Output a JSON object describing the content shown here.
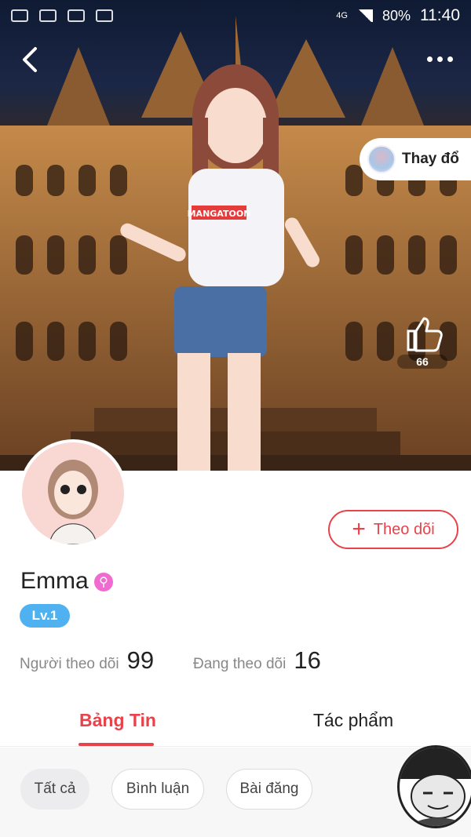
{
  "status_bar": {
    "time": "11:40",
    "battery": "80%",
    "network": "4G"
  },
  "header": {
    "back_icon": "chevron-left-icon",
    "more_icon": "more-horizontal-icon"
  },
  "hero": {
    "shirt_text": "MANGATOON",
    "change_button_label": "Thay đổ",
    "like_count": "66"
  },
  "profile": {
    "name": "Emma",
    "gender_icon": "female-gender-icon",
    "level": "Lv.1",
    "follow_button_label": "Theo dõi",
    "followers_label": "Người theo dõi",
    "followers_count": "99",
    "following_label": "Đang theo dõi",
    "following_count": "16"
  },
  "tabs": [
    {
      "label": "Bảng Tin",
      "active": true
    },
    {
      "label": "Tác phẩm",
      "active": false
    }
  ],
  "filters": [
    {
      "label": "Tất cả",
      "active": true
    },
    {
      "label": "Bình luận",
      "active": false
    },
    {
      "label": "Bài đăng",
      "active": false
    }
  ],
  "colors": {
    "accent": "#e8424a",
    "level_badge": "#4fb1ef",
    "gender_badge": "#f06ad0"
  }
}
